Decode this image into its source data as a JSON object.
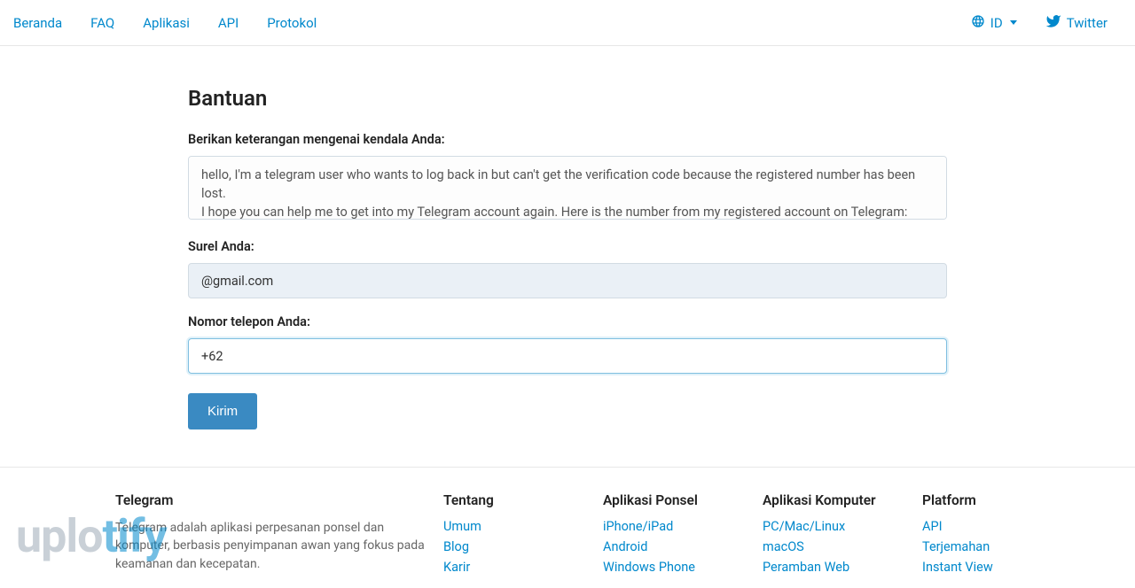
{
  "nav": {
    "items": [
      "Beranda",
      "FAQ",
      "Aplikasi",
      "API",
      "Protokol"
    ],
    "lang": "ID",
    "twitter": "Twitter"
  },
  "page": {
    "title": "Bantuan",
    "desc_label": "Berikan keterangan mengenai kendala Anda:",
    "desc_value": "hello, I'm a telegram user who wants to log back in but can't get the verification code because the registered number has been lost.\nI hope you can help me to get into my Telegram account again. Here is the number from my registered account on Telegram:",
    "email_label": "Surel Anda:",
    "email_value": "                      @gmail.com",
    "phone_label": "Nomor telepon Anda:",
    "phone_value": "+62 ",
    "submit": "Kirim"
  },
  "footer": {
    "about": {
      "title": "Telegram",
      "text": "Telegram adalah aplikasi perpesanan ponsel dan komputer, berbasis penyimpanan awan yang fokus pada keamanan dan kecepatan."
    },
    "cols": [
      {
        "title": "Tentang",
        "links": [
          "Umum",
          "Blog",
          "Karir"
        ]
      },
      {
        "title": "Aplikasi Ponsel",
        "links": [
          "iPhone/iPad",
          "Android",
          "Windows Phone"
        ]
      },
      {
        "title": "Aplikasi Komputer",
        "links": [
          "PC/Mac/Linux",
          "macOS",
          "Peramban Web"
        ]
      },
      {
        "title": "Platform",
        "links": [
          "API",
          "Terjemahan",
          "Instant View"
        ]
      }
    ]
  },
  "watermark": {
    "a": "uplo",
    "b": "tify"
  }
}
